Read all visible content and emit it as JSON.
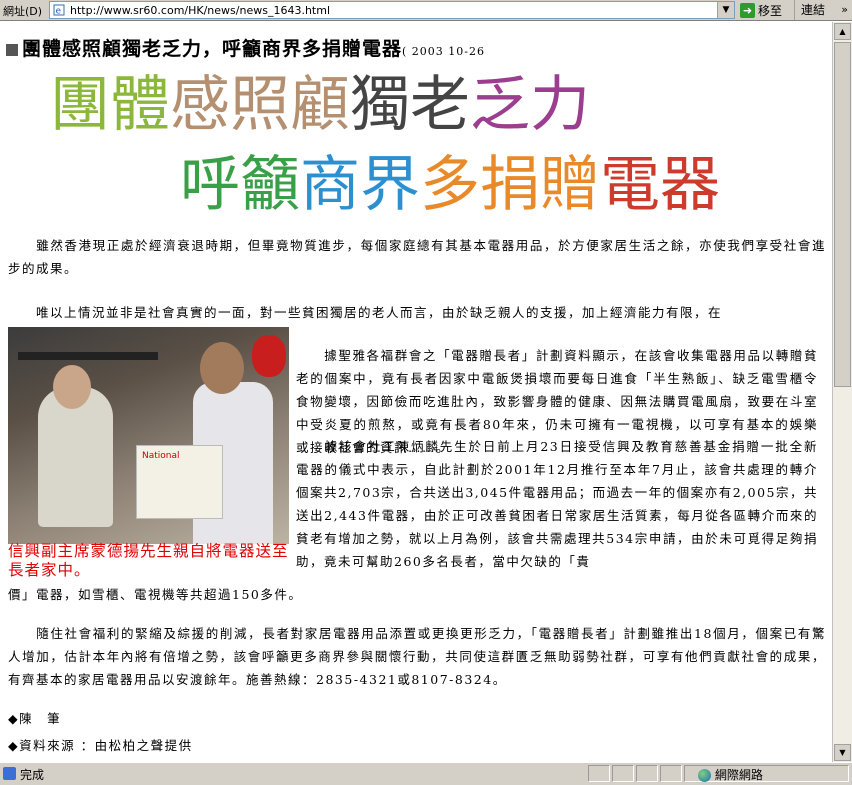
{
  "toolbar": {
    "address_label": "網址(D)",
    "url": "http://www.sr60.com/HK/news/news_1643.html",
    "go_label": "移至",
    "links_label": "連結"
  },
  "article": {
    "headline": "團體感照顧獨老乏力，呼籲商界多捐贈電器",
    "date": "( 2003 10-26",
    "banner_line1": [
      {
        "text": "團體",
        "color": "#8bb83a"
      },
      {
        "text": "感照顧",
        "color": "#b49070"
      },
      {
        "text": "獨老",
        "color": "#444444"
      },
      {
        "text": "乏力",
        "color": "#9b3e8f"
      }
    ],
    "banner_line2": [
      {
        "text": "呼籲",
        "color": "#3aa048"
      },
      {
        "text": "商界",
        "color": "#2c8fd0"
      },
      {
        "text": "多捐贈",
        "color": "#e98a2a"
      },
      {
        "text": "電器",
        "color": "#cc3b2c"
      }
    ],
    "para1": "　　雖然香港現正處於經濟衰退時期，但畢竟物質進步，每個家庭總有其基本電器用品，於方便家居生活之餘，亦使我們享受社會進步的成果。",
    "para2": "　　唯以上情況並非是社會真實的一面，對一些貧困獨居的老人而言，由於缺乏親人的支援，加上經濟能力有限，在",
    "para3": "　　據聖雅各福群會之「電器贈長者」計劃資料顯示，在該會收集電器用品以轉贈貧老的個案中，竟有長者因家中電飯煲損壞而要每日進食「半生熟飯」、缺乏電雪櫃令食物變壞，因節儉而吃進肚內，致影響身體的健康、因無法購買電風扇，致要在斗室中受炎夏的煎熬，或竟有長者80年來，仍未可擁有一電視機，以可享有基本的娛樂或接收社會的資訊……。",
    "para4a": "　　據該會社工陳炳麟先生於日前上月23日接受信興及教育慈善基金捐贈一批全新電器的儀式中表示，自此計劃於2001年12月推行至本年7月止，該會共處理的轉介個案共2,703宗，合共送出3,045件電器用品；而過去一年的個案亦有2,005宗，共送出2,443件電器，由於正可改善貧困者日常家居生活質素，每月從各區轉介而來的貧老有增加之勢，就以上月為例，該會共需處理共534宗申請，由於未可覓得足夠捐助，竟未可幫助260多名長者，當中欠缺的「貴",
    "para4b": "價」電器，如雪櫃、電視機等共超過150多件。",
    "para5": "　　隨住社會福利的緊縮及綜援的削減，長者對家居電器用品添置或更換更形乏力，「電器贈長者」計劃雖推出18個月，個案已有驚人增加，估計本年內將有倍增之勢，該會呼籲更多商界參與關懷行動，共同使這群匱乏無助弱勢社群，可享有他們貢獻社會的成果，有齊基本的家居電器用品以安渡餘年。施善熱線：2835-4321或8107-8324。",
    "author": "◆陳　筆",
    "source": "◆資料來源 ：由松柏之聲提供",
    "photo_caption": "信興副主席蒙德揚先生親自將電器送至長者家中。",
    "photo_box_label": "National"
  },
  "statusbar": {
    "status_text": "完成",
    "zone_text": "網際網路"
  }
}
